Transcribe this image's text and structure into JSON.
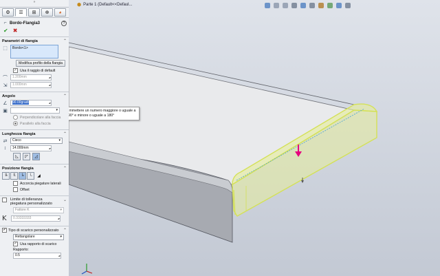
{
  "panel": {
    "pin_glyph": "»",
    "feature_title": "Bordo-Flangia3",
    "help_glyph": "?",
    "ok_glyph": "✔",
    "cancel_glyph": "✖"
  },
  "params": {
    "title": "Parametri di flangia",
    "selection": "Bordo<1>",
    "edit_profile_button": "Modifica profilo della flangia",
    "use_default_radius_label": "Usa il raggio di default",
    "radius_value": "1.200mm",
    "thickness_value": "1.000mm"
  },
  "angle": {
    "title": "Angolo",
    "value": "90.00gradi",
    "perpendicular_label": "Perpendicolare alla faccia",
    "parallel_label": "Parallelo alla faccia"
  },
  "length": {
    "title": "Lunghezza flangia",
    "type_value": "Cieco",
    "value": "14.000mm"
  },
  "position": {
    "title": "Posizione flangia",
    "trim_side_bends_label": "Accorcia piegature laterali",
    "offset_label": "Offset"
  },
  "tolerance": {
    "title": "Limite di tolleranza piegatura personalizzato",
    "factor_value": "Fattore K",
    "k_symbol": "K",
    "k_value": "0.33333333"
  },
  "relief": {
    "title": "Tipo di scarico personalizzato",
    "type_value": "Rettangolare",
    "use_ratio_label": "Usa rapporto di scarico",
    "ratio_label": "Rapporto:",
    "ratio_value": "0.5"
  },
  "viewport": {
    "doc_title": "Parte 1  (Default<<Defaul...",
    "tooltip": "Immettere un numero maggiore o uguale a 90° e minore o uguale a 180°"
  },
  "colors": {
    "accent": "#d4e157",
    "selection": "#d8e8fb",
    "arrow": "#e6007e"
  }
}
